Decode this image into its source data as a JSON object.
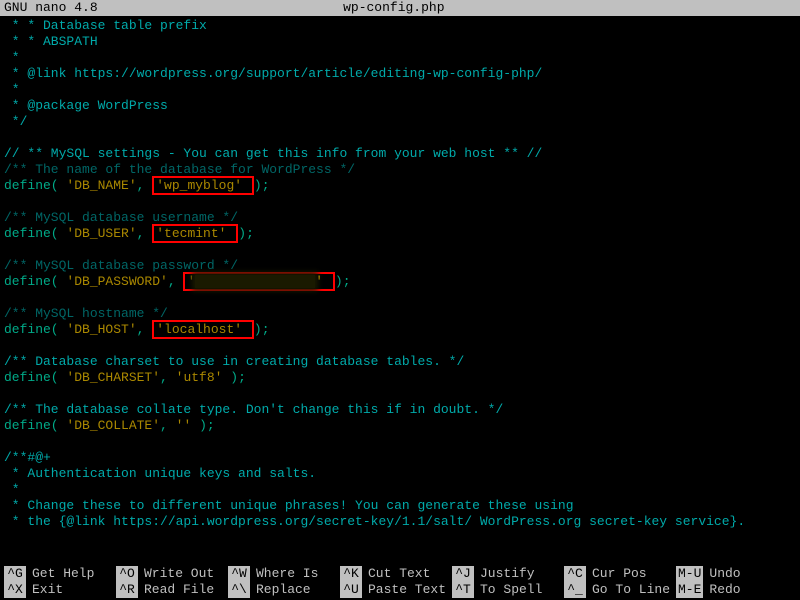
{
  "title": {
    "app": "  GNU nano 4.8",
    "file": "wp-config.php"
  },
  "lines": {
    "l0": " * * Database table prefix",
    "l1": " * * ABSPATH",
    "l2": " *",
    "l3": " * @link https://wordpress.org/support/article/editing-wp-config-php/",
    "l4": " *",
    "l5": " * @package WordPress",
    "l6": " */",
    "blank": " ",
    "l7": "// ** MySQL settings - You can get this info from your web host ** //",
    "l8": "/** The name of the database for WordPress */",
    "def": "define(",
    "cparen": ");",
    "comma": ", ",
    "dbname_k": "'DB_NAME'",
    "dbname_v": "'wp_myblog'",
    "l10": "/** MySQL database username */",
    "dbuser_k": "'DB_USER'",
    "dbuser_v": "'tecmint'",
    "l12": "/** MySQL database password */",
    "dbpass_k": "'DB_PASSWORD'",
    "l14": "/** MySQL hostname */",
    "dbhost_k": "'DB_HOST'",
    "dbhost_v": "'localhost'",
    "l16": "/** Database charset to use in creating database tables. */",
    "dbchar_k": "'DB_CHARSET'",
    "dbchar_v": "'utf8'",
    "l18": "/** The database collate type. Don't change this if in doubt. */",
    "dbcoll_k": "'DB_COLLATE'",
    "dbcoll_v": "''",
    "l20": "/**#@+",
    "l21": " * Authentication unique keys and salts.",
    "l22": " *",
    "l23": " * Change these to different unique phrases! You can generate these using",
    "l24": " * the {@link https://api.wordpress.org/secret-key/1.1/salt/ WordPress.org secret-key service}."
  },
  "shortcuts": {
    "r1": [
      {
        "k": "^G",
        "t": "Get Help"
      },
      {
        "k": "^O",
        "t": "Write Out"
      },
      {
        "k": "^W",
        "t": "Where Is"
      },
      {
        "k": "^K",
        "t": "Cut Text"
      },
      {
        "k": "^J",
        "t": "Justify"
      },
      {
        "k": "^C",
        "t": "Cur Pos"
      },
      {
        "k": "M-U",
        "t": "Undo"
      }
    ],
    "r2": [
      {
        "k": "^X",
        "t": "Exit"
      },
      {
        "k": "^R",
        "t": "Read File"
      },
      {
        "k": "^\\",
        "t": "Replace"
      },
      {
        "k": "^U",
        "t": "Paste Text"
      },
      {
        "k": "^T",
        "t": "To Spell"
      },
      {
        "k": "^_",
        "t": "Go To Line"
      },
      {
        "k": "M-E",
        "t": "Redo"
      }
    ]
  }
}
